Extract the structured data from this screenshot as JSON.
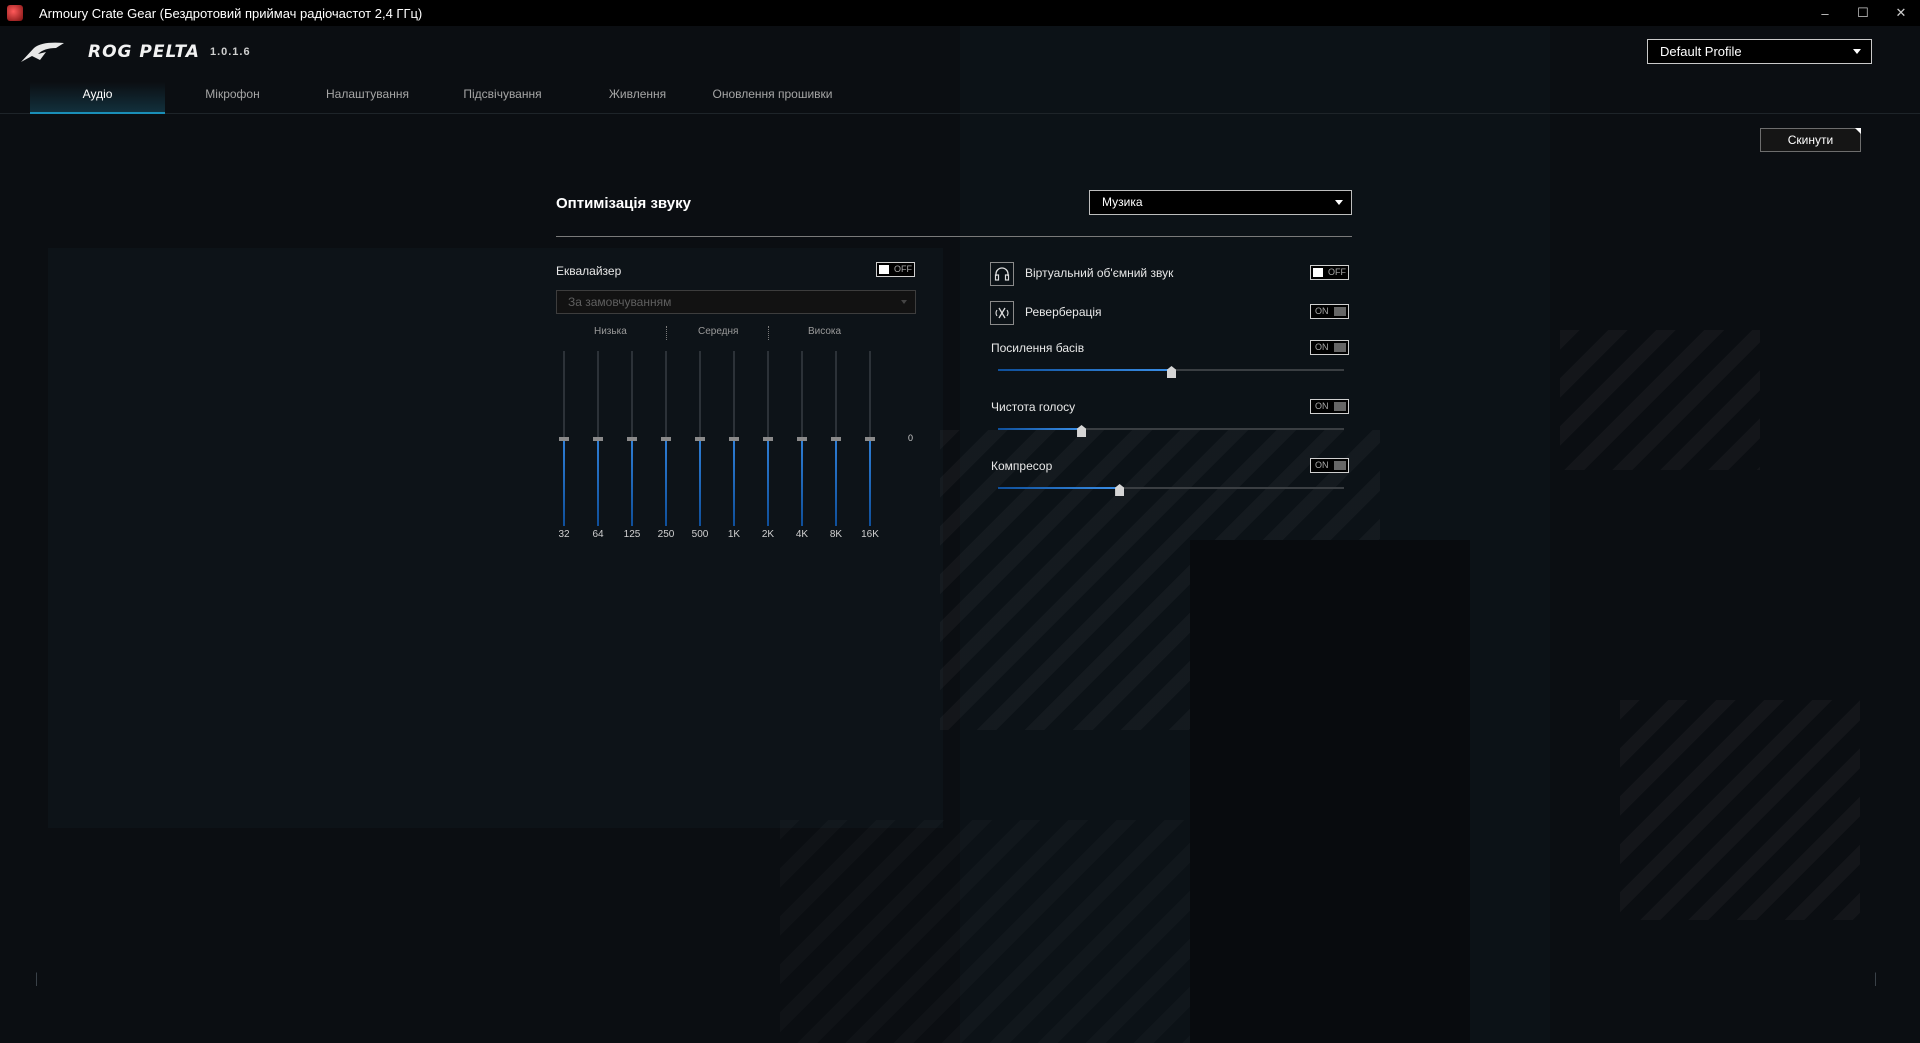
{
  "window": {
    "title": "Armoury Crate Gear (Бездротовий приймач радіочастот 2,4 ГГц)",
    "minimize": "–",
    "maximize": "☐",
    "close": "✕"
  },
  "header": {
    "device_name": "ROG PELTA",
    "version": "1.0.1.6",
    "profile": "Default Profile"
  },
  "tabs": [
    {
      "label": "Аудіо",
      "active": true
    },
    {
      "label": "Мікрофон",
      "active": false
    },
    {
      "label": "Налаштування",
      "active": false
    },
    {
      "label": "Підсвічування",
      "active": false
    },
    {
      "label": "Живлення",
      "active": false
    },
    {
      "label": "Оновлення прошивки",
      "active": false
    }
  ],
  "reset_label": "Скинути",
  "sound": {
    "title": "Оптимізація звуку",
    "mode": "Музика"
  },
  "equalizer": {
    "label": "Еквалайзер",
    "toggle": "OFF",
    "preset_placeholder": "За замовчуванням",
    "bands": {
      "low": "Низька",
      "mid": "Середня",
      "high": "Висока"
    },
    "zero_label": "0",
    "frequencies": [
      "32",
      "64",
      "125",
      "250",
      "500",
      "1K",
      "2K",
      "4K",
      "8K",
      "16K"
    ],
    "gains": [
      0,
      0,
      0,
      0,
      0,
      0,
      0,
      0,
      0,
      0
    ]
  },
  "features": {
    "virtual_surround": {
      "label": "Віртуальний об'ємний звук",
      "toggle": "OFF",
      "icon": "headphones-icon"
    },
    "reverb": {
      "label": "Реверберація",
      "toggle": "ON",
      "icon": "reverb-icon"
    },
    "bass_boost": {
      "label": "Посилення басів",
      "toggle": "ON",
      "level": 0.5
    },
    "voice_clarity": {
      "label": "Чистота голосу",
      "toggle": "ON",
      "level": 0.24
    },
    "compressor": {
      "label": "Компресор",
      "toggle": "ON",
      "level": 0.35
    }
  },
  "colors": {
    "accent": "#1a8fb8",
    "slider_fill": "#2f7fd6"
  }
}
